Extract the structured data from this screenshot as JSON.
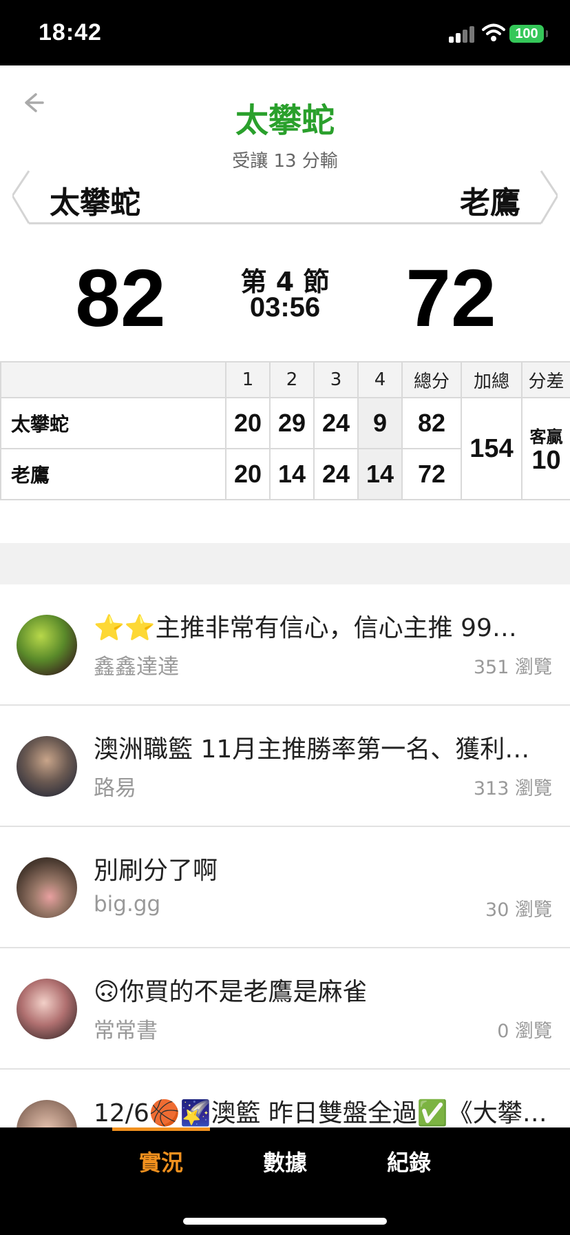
{
  "status_bar": {
    "time": "18:42",
    "battery": "100"
  },
  "header": {
    "title": "太攀蛇",
    "subtitle": "受讓 13 分輸",
    "home_team": "太攀蛇",
    "away_team": "老鷹"
  },
  "scoreboard": {
    "home_score": "82",
    "away_score": "72",
    "period": "第 4 節",
    "clock": "03:56"
  },
  "box_score": {
    "headers": [
      "1",
      "2",
      "3",
      "4",
      "總分",
      "加總",
      "分差"
    ],
    "rows": [
      {
        "team": "太攀蛇",
        "q1": "20",
        "q2": "29",
        "q3": "24",
        "q4": "9",
        "total": "82"
      },
      {
        "team": "老鷹",
        "q1": "20",
        "q2": "14",
        "q3": "24",
        "q4": "14",
        "total": "72"
      }
    ],
    "sum": "154",
    "diff_label": "客贏",
    "diff_value": "10"
  },
  "posts": [
    {
      "title": "⭐⭐主推非常有信心，信心主推 99…",
      "author": "鑫鑫達達",
      "views": "351 瀏覽"
    },
    {
      "title": "澳洲職籃 11月主推勝率第一名、獲利…",
      "author": "路易",
      "views": "313 瀏覽"
    },
    {
      "title": "別刷分了啊",
      "author": "big.gg",
      "views": "30 瀏覽"
    },
    {
      "title": "🙃你買的不是老鷹是麻雀",
      "author": "常常書",
      "views": "0 瀏覽"
    },
    {
      "title": "12/6🏀🌠澳籃 昨日雙盤全過✅《大攀…",
      "author": "",
      "views": ""
    }
  ],
  "tabs": [
    {
      "label": "實況",
      "active": true
    },
    {
      "label": "數據",
      "active": false
    },
    {
      "label": "紀錄",
      "active": false
    }
  ],
  "colors": {
    "accent_green": "#2aa02c",
    "accent_orange": "#f0901e"
  }
}
